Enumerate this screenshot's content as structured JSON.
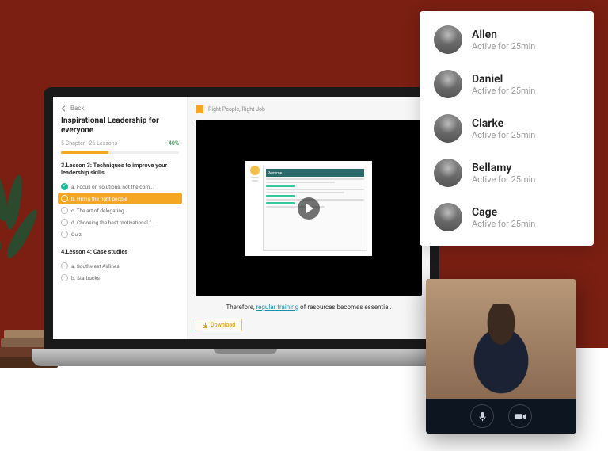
{
  "sidebar": {
    "back": "Back",
    "title": "Inspirational Leadership for everyone",
    "meta": "5 Chapter  ·  26 Lessons",
    "progress_pct": "40%",
    "progress_val": 40,
    "lesson3_head": "3.Lesson 3: Techniques to improve your leadership skills.",
    "items3": [
      {
        "label": "a. Focus on solutions, not the com...",
        "state": "done"
      },
      {
        "label": "b. Hiring the right people",
        "state": "active"
      },
      {
        "label": "c. The art of delegating.",
        "state": ""
      },
      {
        "label": "d. Choosing the best motivational f...",
        "state": ""
      },
      {
        "label": "Quiz",
        "state": ""
      }
    ],
    "lesson4_head": "4.Lesson 4: Case studies",
    "items4": [
      {
        "label": "a. Southwest Airlines",
        "state": ""
      },
      {
        "label": "b. Starbucks",
        "state": ""
      }
    ]
  },
  "main": {
    "crumb": "Right People, Right Job",
    "resume_head": "Resume",
    "caption_pre": "Therefore, ",
    "caption_hl": "regular training",
    "caption_post": " of resources becomes essential.",
    "download": "Download"
  },
  "users": [
    {
      "name": "Allen",
      "status": "Active for 25min"
    },
    {
      "name": "Daniel",
      "status": "Active for 25min"
    },
    {
      "name": "Clarke",
      "status": "Active for 25min"
    },
    {
      "name": "Bellamy",
      "status": "Active for 25min"
    },
    {
      "name": "Cage",
      "status": "Active for 25min"
    }
  ]
}
